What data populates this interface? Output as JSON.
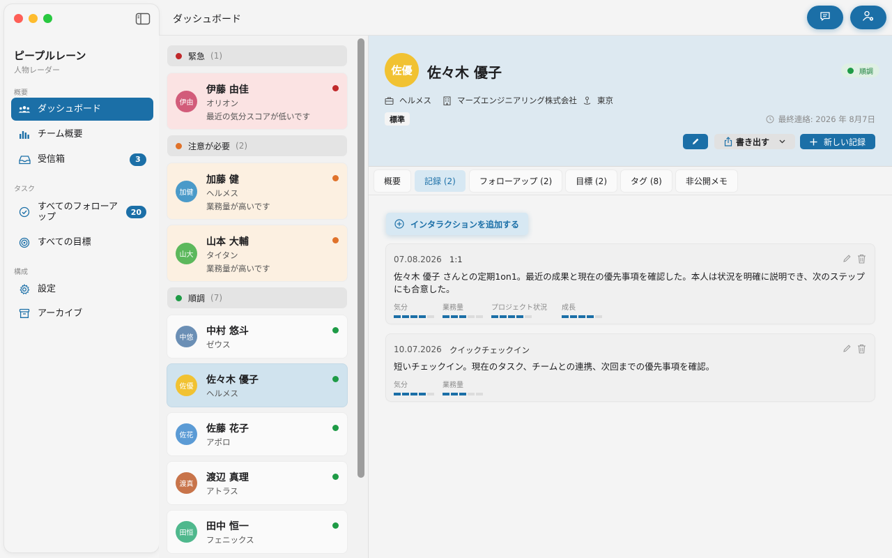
{
  "sidebar": {
    "app_title": "ピープルレーン",
    "app_subtitle": "人物レーダー",
    "sections": {
      "overview": "概要",
      "tasks": "タスク",
      "config": "構成"
    },
    "items": [
      {
        "label": "ダッシュボード",
        "icon": "people-icon",
        "active": true
      },
      {
        "label": "チーム概要",
        "icon": "bar-chart-icon"
      },
      {
        "label": "受信箱",
        "icon": "inbox-icon",
        "badge": "3"
      },
      {
        "label": "すべてのフォローアップ",
        "icon": "check-circle-icon",
        "badge": "20"
      },
      {
        "label": "すべての目標",
        "icon": "target-icon"
      },
      {
        "label": "設定",
        "icon": "gear-icon"
      },
      {
        "label": "アーカイブ",
        "icon": "archive-icon"
      }
    ]
  },
  "toolbar": {
    "title": "ダッシュボード"
  },
  "list": {
    "groups": [
      {
        "label": "緊急",
        "count": "(1)",
        "color": "#c0292b"
      },
      {
        "label": "注意が必要",
        "count": "(2)",
        "color": "#e0722a"
      },
      {
        "label": "順調",
        "count": "(7)",
        "color": "#1e9b46"
      }
    ],
    "people": [
      {
        "initials": "伊由",
        "name": "伊藤 由佳",
        "company": "オリオン",
        "note": "最近の気分スコアが低いです",
        "avatar_color": "#d25c7a",
        "status_color": "#c0292b",
        "bg": "#fbe3e3"
      },
      {
        "initials": "加健",
        "name": "加藤 健",
        "company": "ヘルメス",
        "note": "業務量が高いです",
        "avatar_color": "#4a9ac9",
        "status_color": "#e0722a",
        "bg": "#fcf0e1"
      },
      {
        "initials": "山大",
        "name": "山本 大輔",
        "company": "タイタン",
        "note": "業務量が高いです",
        "avatar_color": "#5cb85c",
        "status_color": "#e0722a",
        "bg": "#fcf0e1"
      },
      {
        "initials": "中悠",
        "name": "中村 悠斗",
        "company": "ゼウス",
        "avatar_color": "#6b8fb5",
        "status_color": "#1e9b46",
        "bg": "#fafafa"
      },
      {
        "initials": "佐優",
        "name": "佐々木 優子",
        "company": "ヘルメス",
        "avatar_color": "#f1c232",
        "status_color": "#1e9b46",
        "bg": "#d0e3ee",
        "selected": true
      },
      {
        "initials": "佐花",
        "name": "佐藤 花子",
        "company": "アポロ",
        "avatar_color": "#5b9bd5",
        "status_color": "#1e9b46",
        "bg": "#fafafa"
      },
      {
        "initials": "渡真",
        "name": "渡辺 真理",
        "company": "アトラス",
        "avatar_color": "#c8744a",
        "status_color": "#1e9b46",
        "bg": "#fafafa"
      },
      {
        "initials": "田恒",
        "name": "田中 恒一",
        "company": "フェニックス",
        "avatar_color": "#4fb88d",
        "status_color": "#1e9b46",
        "bg": "#fafafa"
      }
    ]
  },
  "detail": {
    "initials": "佐優",
    "name": "佐々木 優子",
    "status": "順調",
    "team": "ヘルメス",
    "company": "マーズエンジニアリング株式会社",
    "location": "東京",
    "tier": "標準",
    "last_contact": "最終連絡: 2026 年 8月7日",
    "buttons": {
      "export": "書き出す",
      "new_record": "新しい記録"
    },
    "tabs": [
      "概要",
      "記録 (2)",
      "フォローアップ (2)",
      "目標 (2)",
      "タグ (8)",
      "非公開メモ"
    ],
    "add_interaction": "インタラクションを追加する",
    "records": [
      {
        "date": "07.08.2026",
        "type": "1:1",
        "text": "佐々木 優子 さんとの定期1on1。最近の成果と現在の優先事項を確認した。本人は状況を明確に説明でき、次のステップにも合意した。",
        "metrics": [
          {
            "label": "気分",
            "value": 4
          },
          {
            "label": "業務量",
            "value": 3
          },
          {
            "label": "プロジェクト状況",
            "value": 4
          },
          {
            "label": "成長",
            "value": 4
          }
        ]
      },
      {
        "date": "10.07.2026",
        "type": "クイックチェックイン",
        "text": "短いチェックイン。現在のタスク、チームとの連携、次回までの優先事項を確認。",
        "metrics": [
          {
            "label": "気分",
            "value": 4
          },
          {
            "label": "業務量",
            "value": 3
          }
        ]
      }
    ]
  },
  "colors": {
    "accent": "#1b6fa7",
    "urgent": "#c0292b",
    "warning": "#e0722a",
    "ok": "#1e9b46"
  }
}
